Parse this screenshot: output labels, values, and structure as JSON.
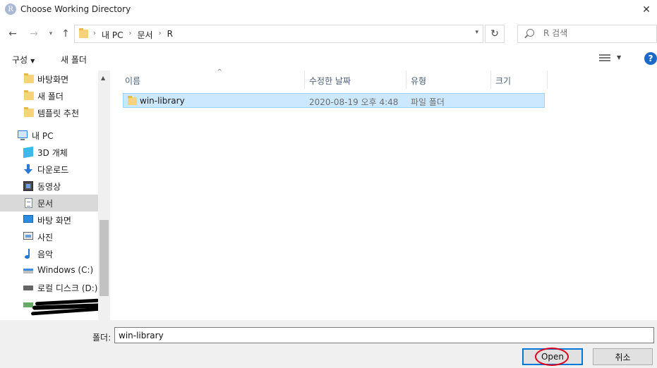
{
  "window": {
    "title": "Choose Working Directory",
    "app_icon_letter": "R",
    "close_glyph": "✕"
  },
  "address": {
    "breadcrumbs": [
      "내 PC",
      "문서",
      "R"
    ],
    "search_placeholder": "R 검색"
  },
  "toolbar": {
    "organize_label": "구성",
    "new_folder_label": "새 폴더",
    "help_glyph": "?"
  },
  "navigation": {
    "items": [
      {
        "label": "바탕화면",
        "icon": "folder-icon"
      },
      {
        "label": "새 폴더",
        "icon": "folder-icon"
      },
      {
        "label": "템플릿 추천",
        "icon": "folder-icon"
      },
      {
        "label": "내 PC",
        "icon": "computer-icon"
      },
      {
        "label": "3D 개체",
        "icon": "3d-objects-icon"
      },
      {
        "label": "다운로드",
        "icon": "download-icon"
      },
      {
        "label": "동영상",
        "icon": "video-icon"
      },
      {
        "label": "문서",
        "icon": "documents-icon",
        "selected": true
      },
      {
        "label": "바탕 화면",
        "icon": "desktop-icon"
      },
      {
        "label": "사진",
        "icon": "pictures-icon"
      },
      {
        "label": "음악",
        "icon": "music-icon"
      },
      {
        "label": "Windows (C:)",
        "icon": "drive-icon"
      },
      {
        "label": "로컬 디스크 (D:)",
        "icon": "drive-icon"
      }
    ]
  },
  "columns": {
    "name": "이름",
    "date": "수정한 날짜",
    "type": "유형",
    "size": "크기"
  },
  "files": [
    {
      "name": "win-library",
      "date": "2020-08-19 오후 4:48",
      "type": "파일 폴더",
      "size": ""
    }
  ],
  "footer": {
    "folder_label": "폴더:",
    "folder_value": "win-library",
    "open_label": "Open",
    "cancel_label": "취소"
  }
}
